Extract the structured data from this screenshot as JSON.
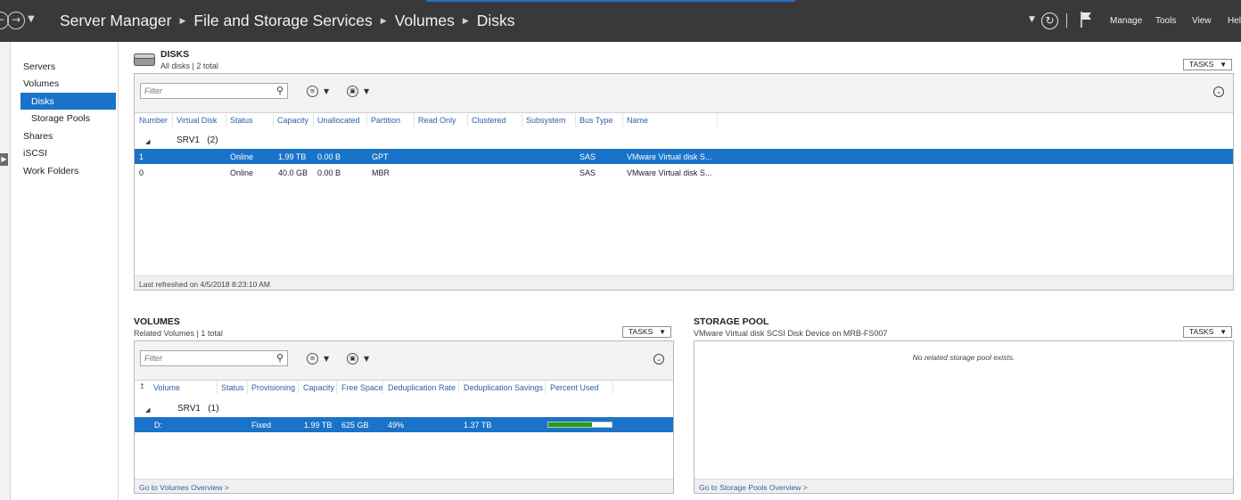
{
  "titlebar": {
    "breadcrumbs": [
      "Server Manager",
      "File and Storage Services",
      "Volumes",
      "Disks"
    ],
    "menu": [
      "Manage",
      "Tools",
      "View",
      "Help"
    ]
  },
  "sidebar": {
    "items": [
      {
        "label": "Servers"
      },
      {
        "label": "Volumes"
      },
      {
        "label": "Disks",
        "selected": true
      },
      {
        "label": "Storage Pools"
      },
      {
        "label": "Shares"
      },
      {
        "label": "iSCSI"
      },
      {
        "label": "Work Folders"
      }
    ]
  },
  "disks": {
    "title": "DISKS",
    "subtitle": "All disks | 2 total",
    "tasks_label": "TASKS",
    "filter_placeholder": "Filter",
    "columns": [
      "Number",
      "Virtual Disk",
      "Status",
      "Capacity",
      "Unallocated",
      "Partition",
      "Read Only",
      "Clustered",
      "Subsystem",
      "Bus Type",
      "Name"
    ],
    "group": {
      "name": "SRV1",
      "count": "(2)"
    },
    "rows": [
      {
        "number": "1",
        "virtual_disk": "",
        "status": "Online",
        "capacity": "1.99 TB",
        "unallocated": "0.00 B",
        "partition": "GPT",
        "read_only": "",
        "clustered": "",
        "subsystem": "",
        "bus_type": "SAS",
        "name": "VMware Virtual disk S...",
        "selected": true
      },
      {
        "number": "0",
        "virtual_disk": "",
        "status": "Online",
        "capacity": "40.0 GB",
        "unallocated": "0.00 B",
        "partition": "MBR",
        "read_only": "",
        "clustered": "",
        "subsystem": "",
        "bus_type": "SAS",
        "name": "VMware Virtual disk S...",
        "selected": false
      }
    ],
    "footer": "Last refreshed on 4/5/2018 8:23:10 AM"
  },
  "volumes": {
    "title": "VOLUMES",
    "subtitle": "Related Volumes | 1 total",
    "tasks_label": "TASKS",
    "filter_placeholder": "Filter",
    "columns": [
      "Volume",
      "Status",
      "Provisioning",
      "Capacity",
      "Free Space",
      "Deduplication Rate",
      "Deduplication Savings",
      "Percent Used"
    ],
    "group": {
      "name": "SRV1",
      "count": "(1)"
    },
    "rows": [
      {
        "volume": "D:",
        "status": "",
        "provisioning": "Fixed",
        "capacity": "1.99 TB",
        "free_space": "625 GB",
        "dedup_rate": "49%",
        "dedup_savings": "1.37 TB",
        "percent_used": 0.69,
        "selected": true
      }
    ],
    "footer": "Go to Volumes Overview >"
  },
  "storage_pool": {
    "title": "STORAGE POOL",
    "subtitle": "VMware Virtual disk SCSI Disk Device on MRB-FS007",
    "tasks_label": "TASKS",
    "empty_message": "No related storage pool exists.",
    "footer": "Go to Storage Pools Overview >"
  },
  "colors": {
    "titlebar_bg": "#393939",
    "selection": "#1a73c8",
    "progress_fill": "#21a121"
  }
}
